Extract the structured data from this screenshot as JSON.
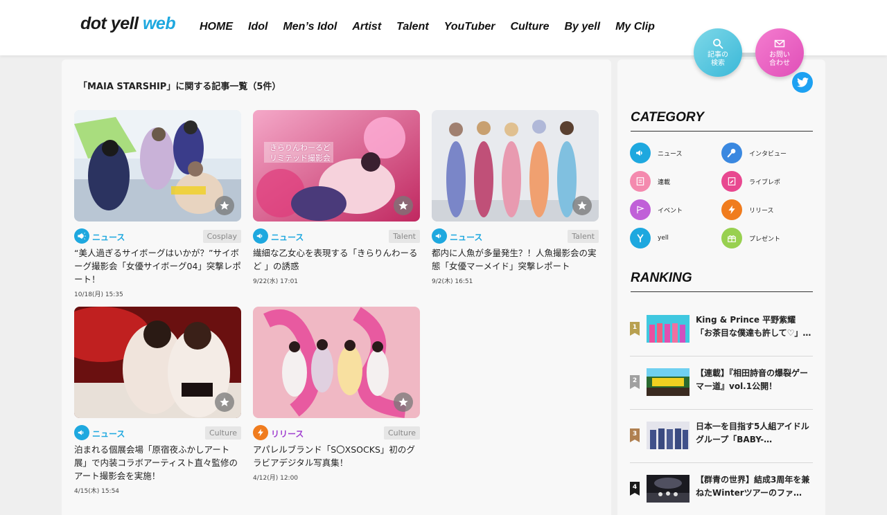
{
  "header": {
    "logo_part1": "dot yell",
    "logo_part2": "web",
    "nav": [
      "HOME",
      "Idol",
      "Men’s Idol",
      "Artist",
      "Talent",
      "YouTuber",
      "Culture",
      "By yell",
      "My Clip"
    ],
    "search_label_1": "記事の",
    "search_label_2": "検索",
    "contact_label_1": "お問い",
    "contact_label_2": "合わせ"
  },
  "main": {
    "list_title": "「MAIA STARSHIP」に関する記事一覧（5件）",
    "articles": [
      {
        "category": "ニュース",
        "tag": "Cosplay",
        "title": "“美人過ぎるサイボーグはいかが？”サイボーグ撮影会「女優サイボーグ04」突撃レポート！",
        "date": "10/18(月) 15:35"
      },
      {
        "category": "ニュース",
        "tag": "Talent",
        "title": "繊細な乙女心を表現する「きらりんわーるど 」の誘惑",
        "date": "9/22(水) 17:01",
        "overlay_1": "きらりんわーるど",
        "overlay_2": "リミテッド撮影会"
      },
      {
        "category": "ニュース",
        "tag": "Talent",
        "title": "都内に人魚が多量発生？！人魚撮影会の実態「女優マーメイド」突撃レポート",
        "date": "9/2(木) 16:51"
      },
      {
        "category": "ニュース",
        "tag": "Culture",
        "title": "泊まれる個展会場「原宿夜ふかしアート展」で内装コラボアーティスト直々監修のアート撮影会を実施！",
        "date": "4/15(木) 15:54"
      },
      {
        "category": "リリース",
        "tag": "Culture",
        "title": "アパレルブランド「S〇XSOCKS」初のグラビアデジタル写真集！",
        "date": "4/12(月) 12:00"
      }
    ]
  },
  "sidebar": {
    "category_heading": "CATEGORY",
    "categories": [
      "ニュース",
      "インタビュー",
      "連載",
      "ライブレポ",
      "イベント",
      "リリース",
      "yell",
      "プレゼント"
    ],
    "ranking_heading": "RANKING",
    "ranking": [
      {
        "rank": "1",
        "title": "King & Prince 平野紫耀「お茶目な僕達も許して♡」…"
      },
      {
        "rank": "2",
        "title": "【連載】『相田詩音の爆裂ゲーマー道』vol.1公開！"
      },
      {
        "rank": "3",
        "title": "日本一を目指す5人組アイドルグループ「BABY-…"
      },
      {
        "rank": "4",
        "title": "【群青の世界】結成3周年を兼ねたWinterツアーのファ…"
      }
    ]
  },
  "colors": {
    "accent_blue": "#1ea8df",
    "news": "#1ea8df",
    "release": "#f07c1e",
    "search_button": "#3ab8d8",
    "contact_button": "#e04fb8",
    "twitter": "#1da1f2"
  },
  "icons": {
    "search": "search-icon",
    "contact": "mail-icon",
    "twitter": "twitter-icon",
    "favorite": "star-icon"
  }
}
